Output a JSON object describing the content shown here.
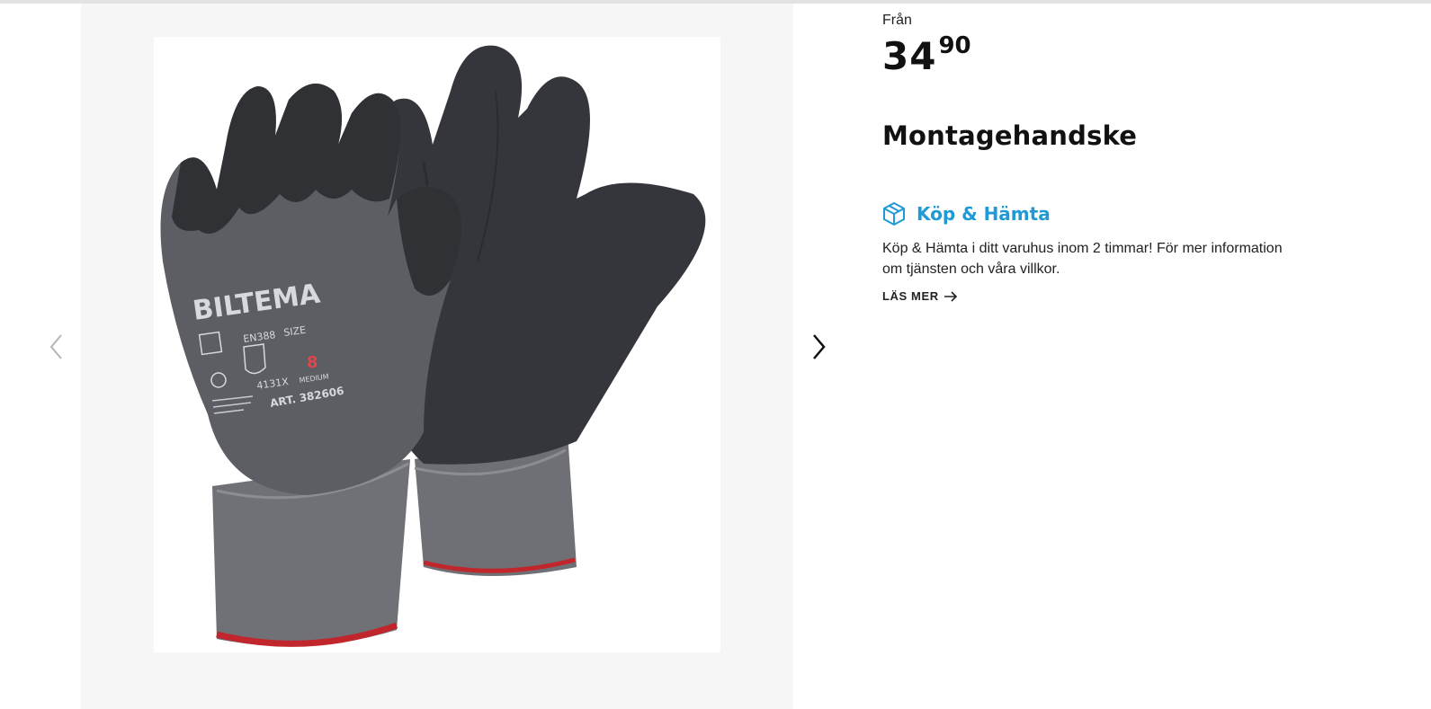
{
  "product": {
    "price_prefix": "Från",
    "price_main": "34",
    "price_cents": "90",
    "title": "Montagehandske",
    "image_alt": "Montagehandske BILTEMA"
  },
  "glove_print": {
    "brand": "BILTEMA",
    "standard": "EN388",
    "size_label": "SIZE",
    "size_number": "8",
    "size_name": "MEDIUM",
    "rating": "4131X",
    "article": "ART. 382606"
  },
  "pickup": {
    "title": "Köp & Hämta",
    "description": "Köp & Hämta i ditt varuhus inom 2 timmar! För mer information om tjänsten och våra villkor.",
    "link_label": "LÄS MER",
    "accent_color": "#1f9ad6"
  },
  "icons": {
    "prev": "chevron-left-icon",
    "next": "chevron-right-icon",
    "pickup": "box-icon",
    "arrow": "arrow-right-icon"
  }
}
